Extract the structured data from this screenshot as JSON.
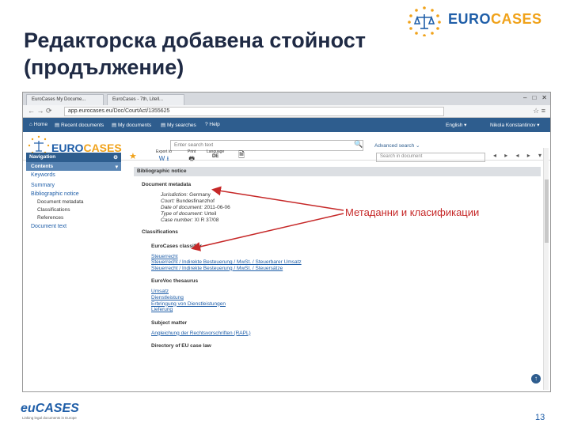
{
  "slide": {
    "title_line1": "Редакторска добавена стойност",
    "title_line2": "(продължение)",
    "logo_top_blue": "EURO",
    "logo_top_orange": "CASES",
    "annotation": "Метаданни и класификации",
    "page_number": "13",
    "bottom_logo_text": "euCASES",
    "bottom_logo_tagline": "Linking legal documents in Europe"
  },
  "browser": {
    "tabs": [
      "EuroCases My Docume...",
      "EuroCases - 7th, Litell..."
    ],
    "url": "app.eurocases.eu/Doc/CourtAct/1355625",
    "window_buttons": [
      "–",
      "□",
      "✕"
    ]
  },
  "navbar": {
    "items": [
      "Home",
      "Recent documents",
      "My documents",
      "My searches",
      "Help"
    ],
    "language": "English",
    "user": "Nikola Konstantinov"
  },
  "header": {
    "logo_blue": "EURO",
    "logo_orange": "CASES",
    "search_placeholder": "Enter search text",
    "advanced_search": "Advanced search"
  },
  "toolbar": {
    "export_label": "Export to",
    "print_label": "Print",
    "language_label": "Language",
    "language_value": "DE",
    "in_document_placeholder": "Search in document"
  },
  "sidebar": {
    "navigation": "Navigation",
    "contents": "Contents",
    "links": [
      "Keywords",
      "Summary",
      "Bibliographic notice"
    ],
    "sub_items": [
      "Document metadata",
      "Classifications",
      "References"
    ],
    "document_text": "Document text"
  },
  "content": {
    "bar_title": "Bibliographic notice",
    "metadata_heading": "Document metadata",
    "metadata": [
      {
        "label": "Jurisdiction:",
        "value": "Germany"
      },
      {
        "label": "Court:",
        "value": "Bundesfinanzhof"
      },
      {
        "label": "Date of document:",
        "value": "2011-06-06"
      },
      {
        "label": "Type of document:",
        "value": "Urteil"
      },
      {
        "label": "Case number:",
        "value": "XI R 37/08"
      }
    ],
    "classifications_heading": "Classifications",
    "eurocases_classifier": "EuroCases classifier",
    "classifier_links": [
      "Steuerrecht",
      "Steuerrecht / Indirekte Besteuerung / MwSt. / Steuerbarer Umsatz",
      "Steuerrecht / Indirekte Besteuerung / MwSt. / Steuersätze"
    ],
    "eurovoc_heading": "EuroVoc thesaurus",
    "eurovoc_links": [
      "Umsatz",
      "Dienstleistung",
      "Erbringung von Dienstleistungen",
      "Lieferung"
    ],
    "subject_heading": "Subject matter",
    "subject_link": "Angleichung der Rechtsvorschriften (RAPL)",
    "directory_heading": "Directory of EU case law"
  }
}
